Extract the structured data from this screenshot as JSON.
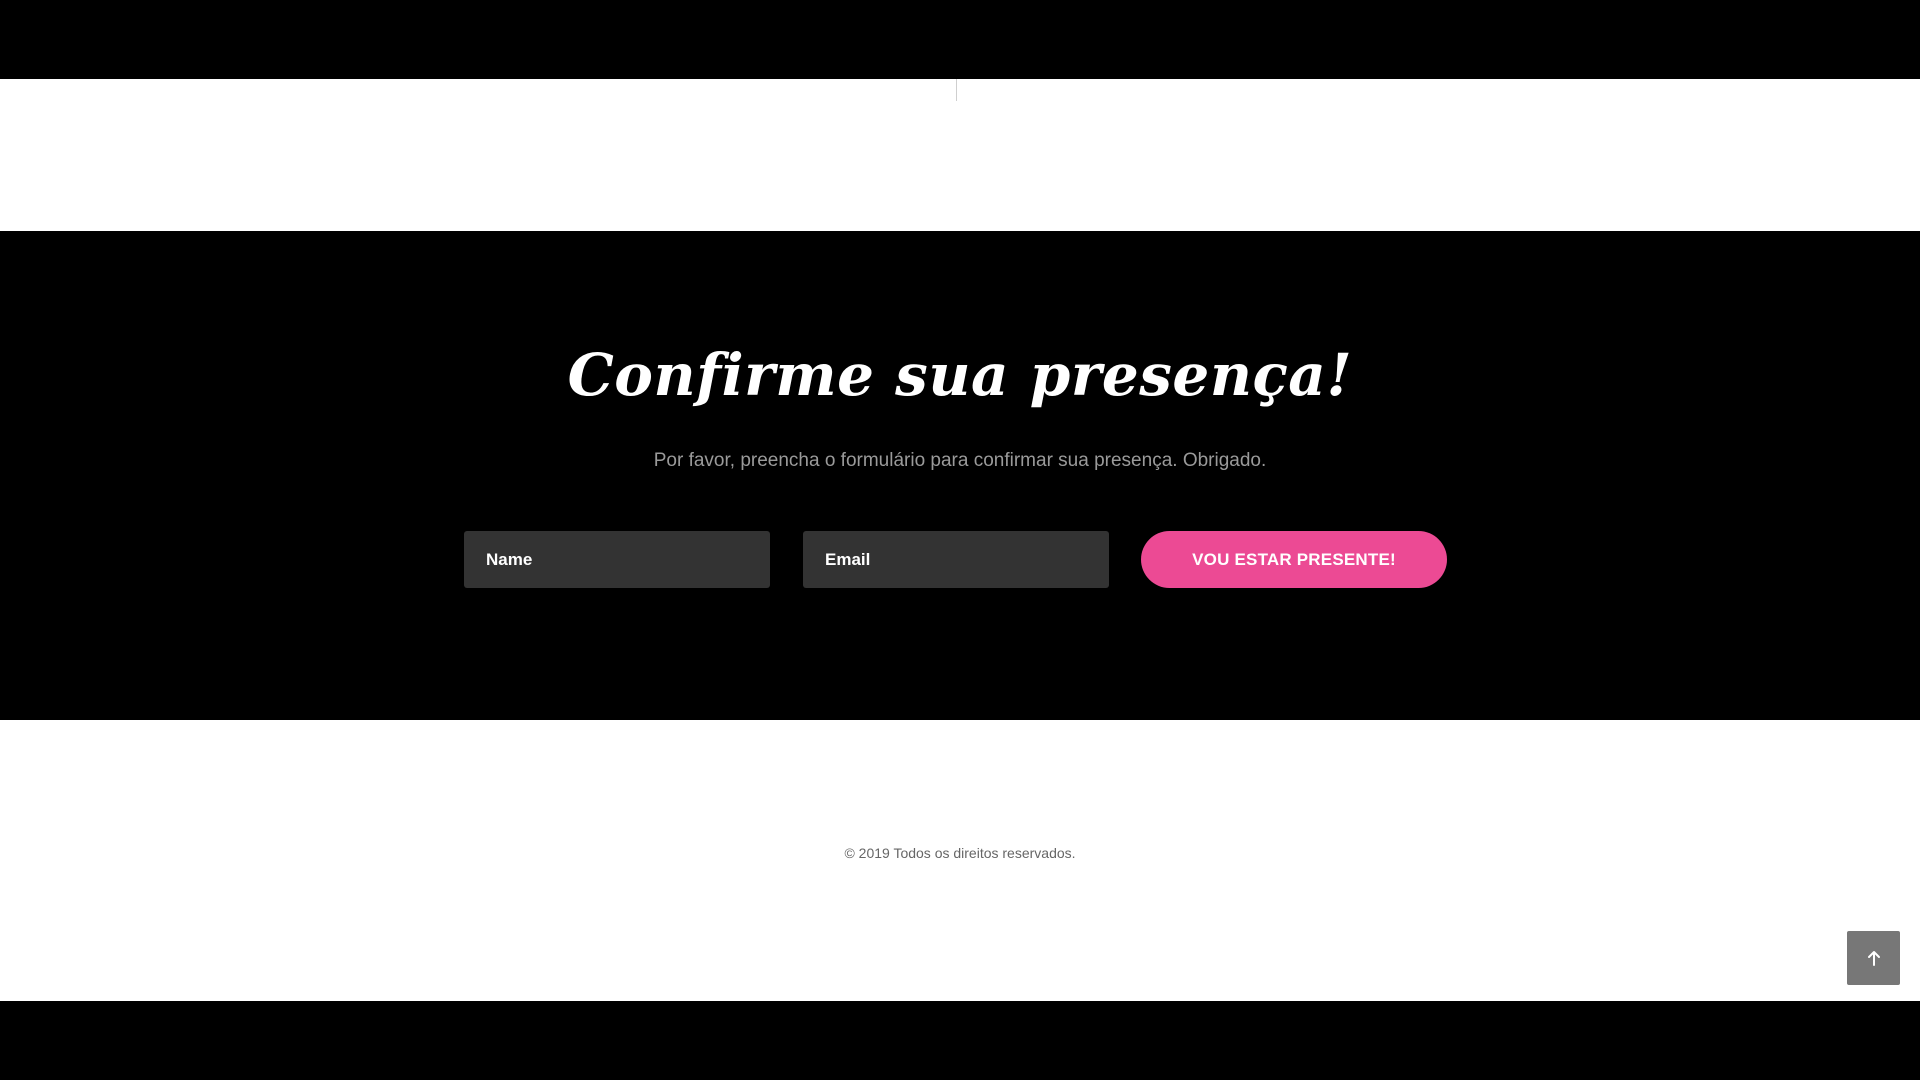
{
  "rsvp": {
    "title": "Confirme sua presença!",
    "subtitle": "Por favor, preencha o formulário para confirmar sua presença. Obrigado.",
    "name_placeholder": "Name",
    "email_placeholder": "Email",
    "submit_label": "VOU ESTAR PRESENTE!"
  },
  "footer": {
    "copyright": "© 2019 Todos os direitos reservados.",
    "back_to_top_icon": "arrow-up-icon"
  },
  "colors": {
    "accent": "#ec4a94",
    "input_bg": "#333333",
    "section_bg": "#000000"
  }
}
